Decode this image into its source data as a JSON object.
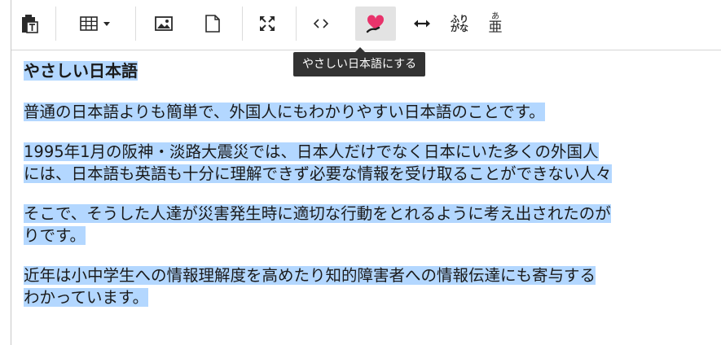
{
  "toolbar": {
    "buttons": [
      {
        "name": "paste-text-button",
        "icon": "clipboard-text-icon"
      },
      {
        "name": "table-button",
        "icon": "table-icon"
      },
      {
        "name": "image-button",
        "icon": "image-icon"
      },
      {
        "name": "page-button",
        "icon": "page-icon"
      },
      {
        "name": "fullscreen-button",
        "icon": "fullscreen-icon"
      },
      {
        "name": "source-button",
        "icon": "code-icon"
      },
      {
        "name": "easy-japanese-button",
        "icon": "heart-hand-icon",
        "color": "#e8336b"
      },
      {
        "name": "width-button",
        "icon": "arrows-horizontal-icon"
      },
      {
        "name": "furigana-button",
        "icon": "furigana-icon",
        "top": "ふり",
        "bottom": "がな"
      },
      {
        "name": "ruby-button",
        "icon": "ruby-icon",
        "top": "あ",
        "bottom": "亜"
      }
    ]
  },
  "tooltip": {
    "text": "やさしい日本語にする"
  },
  "document": {
    "heading": "やさしい日本語",
    "p1": "普通の日本語よりも簡単で、外国人にもわかりやすい日本語のことです。",
    "p2_line1": "1995年1月の阪神・淡路大震災では、日本人だけでなく日本にいた多くの外国人",
    "p2_line2": "には、日本語も英語も十分に理解できず必要な情報を受け取ることができない人々",
    "p3_line1": "そこで、そうした人達が災害発生時に適切な行動をとれるように考え出されたのが",
    "p3_line2": "りです。",
    "p4_line1": "近年は小中学生への情報理解度を高めたり知的障害者への情報伝達にも寄与する",
    "p4_line2": "わかっています。"
  },
  "colors": {
    "selection": "#b3d7ff",
    "tooltip_bg": "#333333",
    "accent": "#e8336b"
  }
}
